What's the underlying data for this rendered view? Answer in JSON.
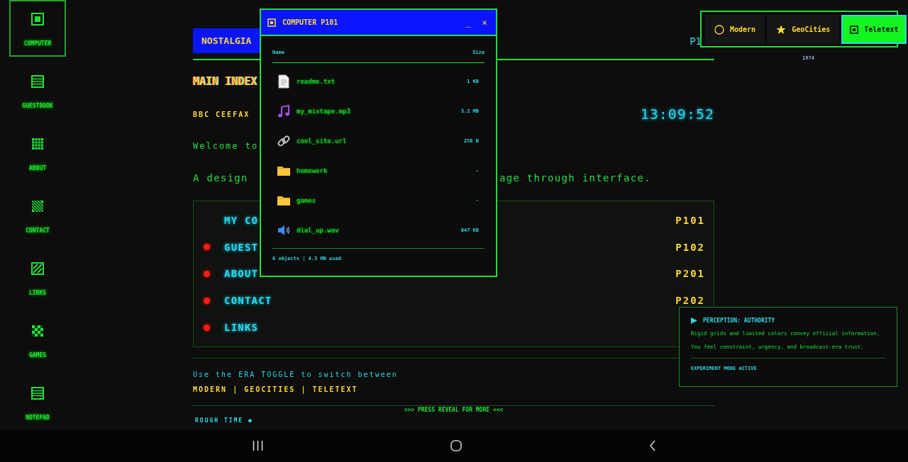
{
  "sidebar": {
    "items": [
      {
        "label": "COMPUTER",
        "kind": "screen",
        "selected": true
      },
      {
        "label": "GUESTBOOK",
        "kind": "lines",
        "selected": false
      },
      {
        "label": "ABOUT",
        "kind": "grid",
        "selected": false
      },
      {
        "label": "CONTACT",
        "kind": "hatch",
        "selected": false
      },
      {
        "label": "LINKS",
        "kind": "stripes",
        "selected": false
      },
      {
        "label": "GAMES",
        "kind": "checker",
        "selected": false
      },
      {
        "label": "NOTEPAD",
        "kind": "lines",
        "selected": false
      }
    ]
  },
  "header": {
    "title": "NOSTALGIA",
    "page": "P1"
  },
  "heading": "MAIN INDEX",
  "service": "BBC CEEFAX",
  "clock": "13:09:52",
  "welcome": "Welcome to",
  "tagline": [
    "A design",
    "age through interface."
  ],
  "menu": [
    {
      "label": "MY CO",
      "page": "P101",
      "bullet": false
    },
    {
      "label": "GUEST",
      "page": "P102",
      "bullet": true
    },
    {
      "label": "ABOUT",
      "page": "P201",
      "bullet": true
    },
    {
      "label": "CONTACT",
      "page": "P202",
      "bullet": true
    },
    {
      "label": "LINKS",
      "bullet": true
    }
  ],
  "hint": {
    "text": "Use the ERA TOGGLE to switch between",
    "options": "MODERN | GEOCITIES | TELETEXT"
  },
  "reveal": ">>> PRESS REVEAL FOR MORE <<<",
  "rough_time": "ROUGH TIME ●",
  "window": {
    "title": "COMPUTER P101",
    "minimize": "_",
    "close": "×",
    "columns": [
      "Name",
      "Size"
    ],
    "files": [
      {
        "name": "readme.txt",
        "size": "1 KB",
        "kind": "text"
      },
      {
        "name": "my_mixtape.mp3",
        "size": "3.2 MB",
        "kind": "music"
      },
      {
        "name": "cool_site.url",
        "size": "256 B",
        "kind": "link"
      },
      {
        "name": "homework",
        "size": "-",
        "kind": "folder"
      },
      {
        "name": "games",
        "size": "-",
        "kind": "folder"
      },
      {
        "name": "dial_up.wav",
        "size": "847 KB",
        "kind": "sound"
      }
    ],
    "footer": "6 objects | 4.3 MB used"
  },
  "era_toggle": {
    "options": [
      {
        "label": "Modern",
        "kind": "circle",
        "selected": false
      },
      {
        "label": "GeoCities",
        "kind": "star",
        "selected": false
      },
      {
        "label": "Teletext",
        "kind": "square",
        "selected": true
      }
    ],
    "year": "1974"
  },
  "perception": {
    "title": "PERCEPTION: AUTHORITY",
    "lines": [
      "Rigid grids and limited colors convey official information.",
      "You feel constraint, urgency, and broadcast-era trust."
    ],
    "status": "EXPERIMENT MODE ACTIVE"
  }
}
